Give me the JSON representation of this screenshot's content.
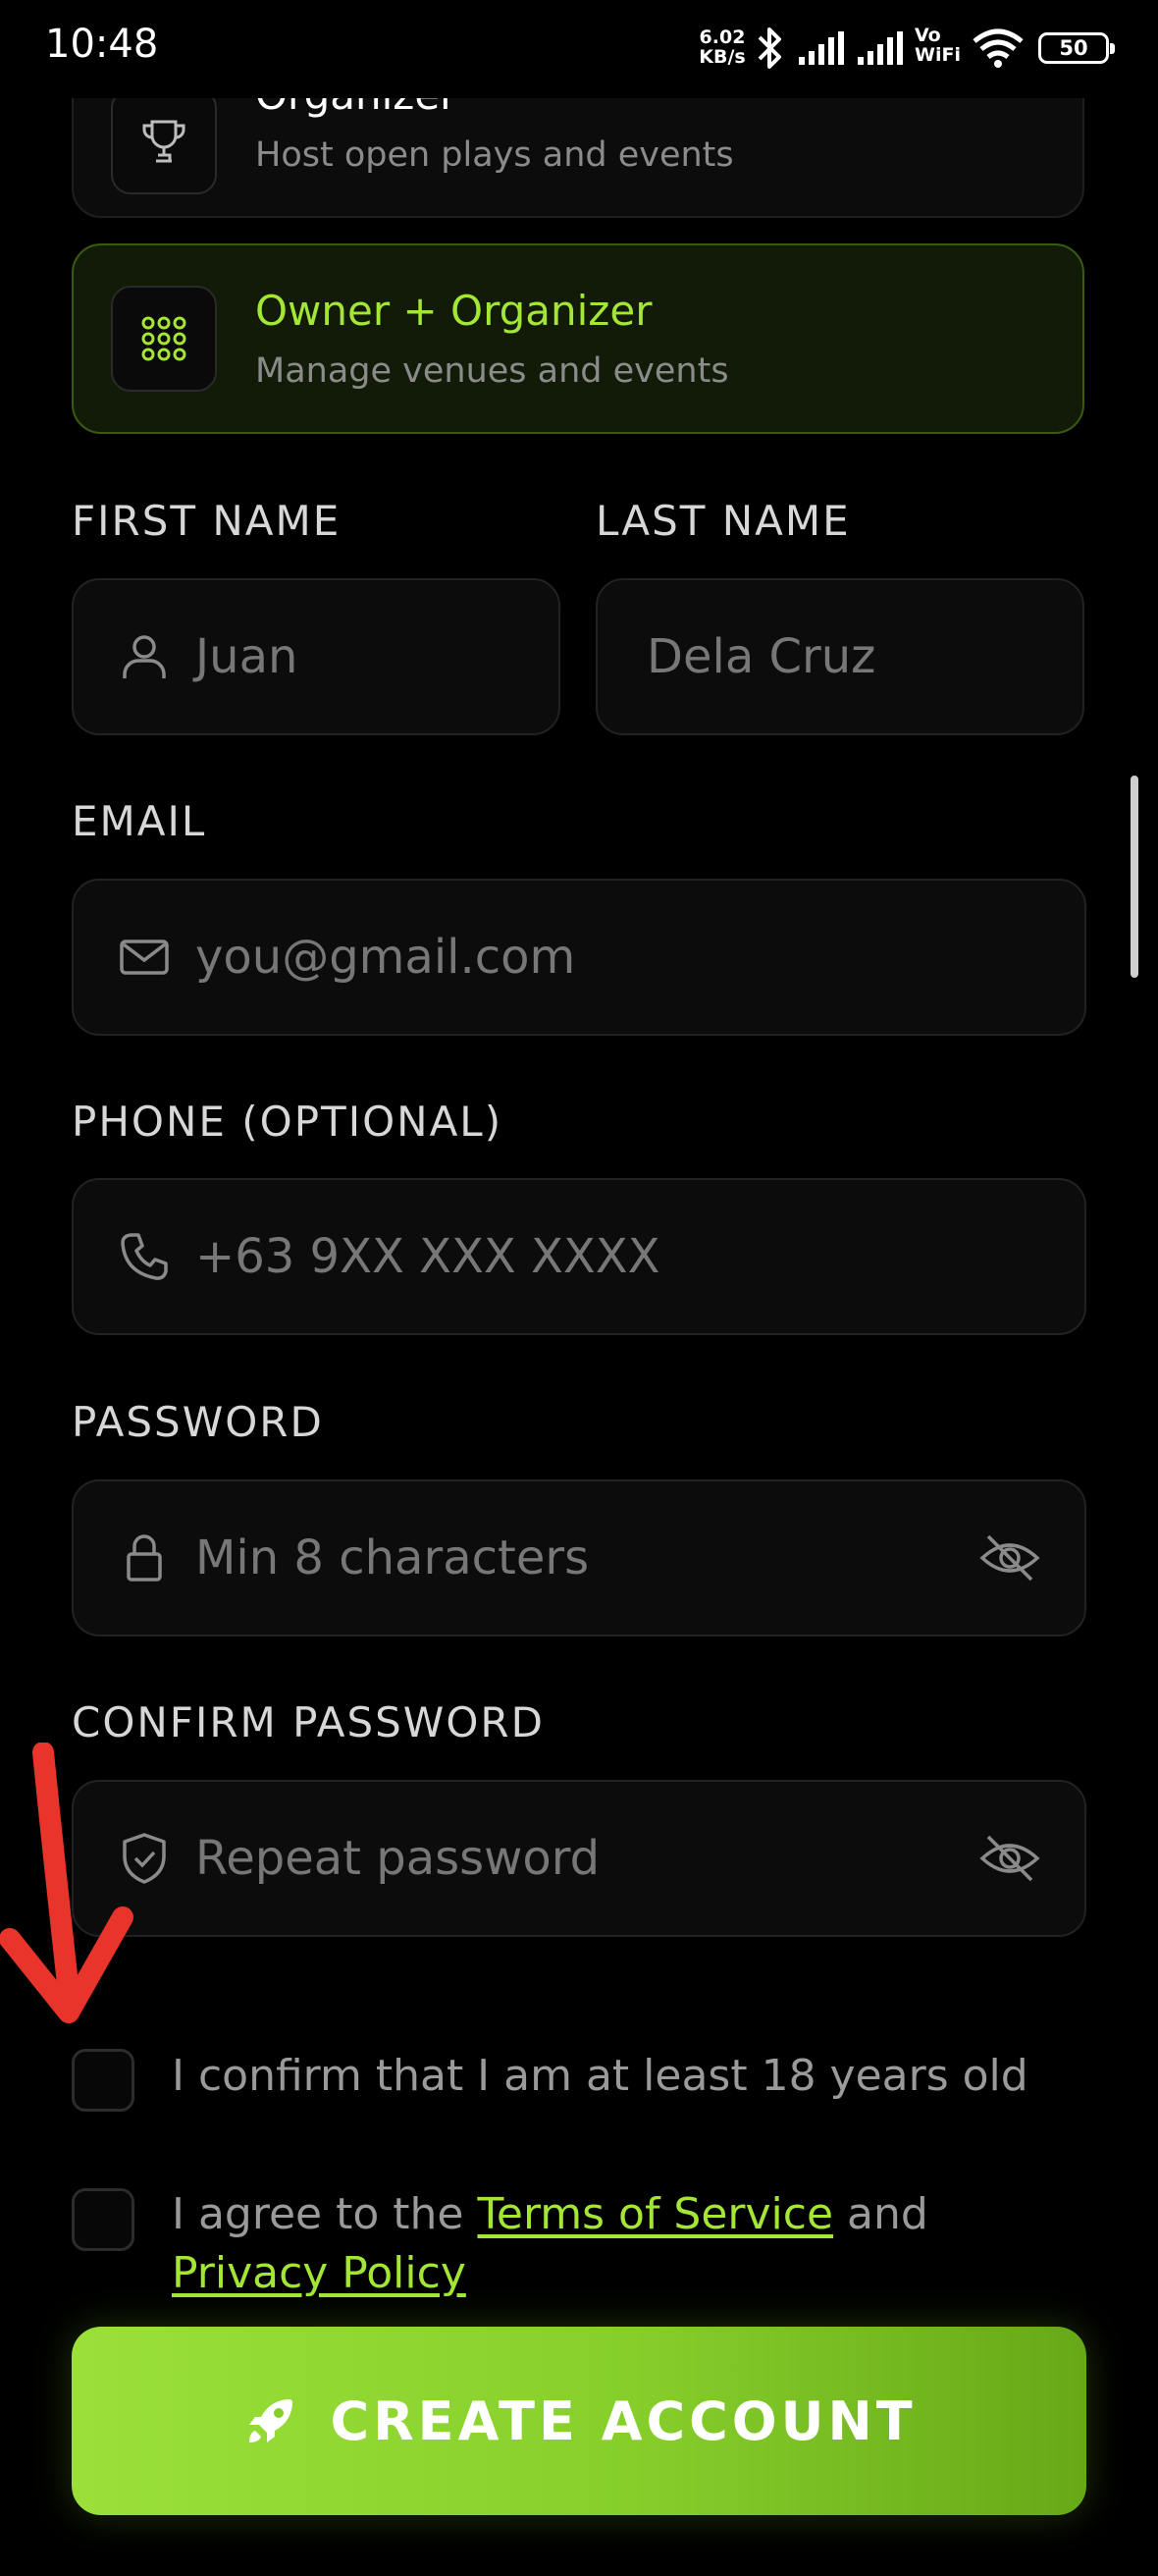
{
  "status_bar": {
    "time": "10:48",
    "net_speed_value": "6.02",
    "net_speed_unit": "KB/s",
    "vowifi_top": "Vo",
    "vowifi_bottom": "WiFi",
    "battery": "50"
  },
  "roles": [
    {
      "title": "Organizer",
      "subtitle": "Host open plays and events",
      "icon": "trophy-icon",
      "selected": false
    },
    {
      "title": "Owner + Organizer",
      "subtitle": "Manage venues and events",
      "icon": "grid-icon",
      "selected": true
    }
  ],
  "form": {
    "first_name": {
      "label": "FIRST NAME",
      "placeholder": "Juan",
      "icon": "user-icon"
    },
    "last_name": {
      "label": "LAST NAME",
      "placeholder": "Dela Cruz"
    },
    "email": {
      "label": "EMAIL",
      "placeholder": "you@gmail.com",
      "icon": "mail-icon"
    },
    "phone": {
      "label": "PHONE (OPTIONAL)",
      "placeholder": "+63 9XX XXX XXXX",
      "icon": "phone-icon"
    },
    "password": {
      "label": "PASSWORD",
      "placeholder": "Min 8 characters",
      "icon": "lock-icon"
    },
    "confirm_password": {
      "label": "CONFIRM PASSWORD",
      "placeholder": "Repeat password",
      "icon": "shield-check-icon"
    }
  },
  "checks": {
    "age": {
      "text": "I confirm that I am at least 18 years old",
      "checked": false
    },
    "terms": {
      "prefix": "I agree to the ",
      "terms_link": "Terms of Service",
      "middle": " and",
      "privacy_link": "Privacy Policy",
      "checked": false
    }
  },
  "create_button": {
    "label": "CREATE ACCOUNT",
    "icon": "rocket-icon"
  },
  "colors": {
    "accent": "#a3e635",
    "background": "#000000",
    "annotation_arrow": "#e8342a"
  }
}
